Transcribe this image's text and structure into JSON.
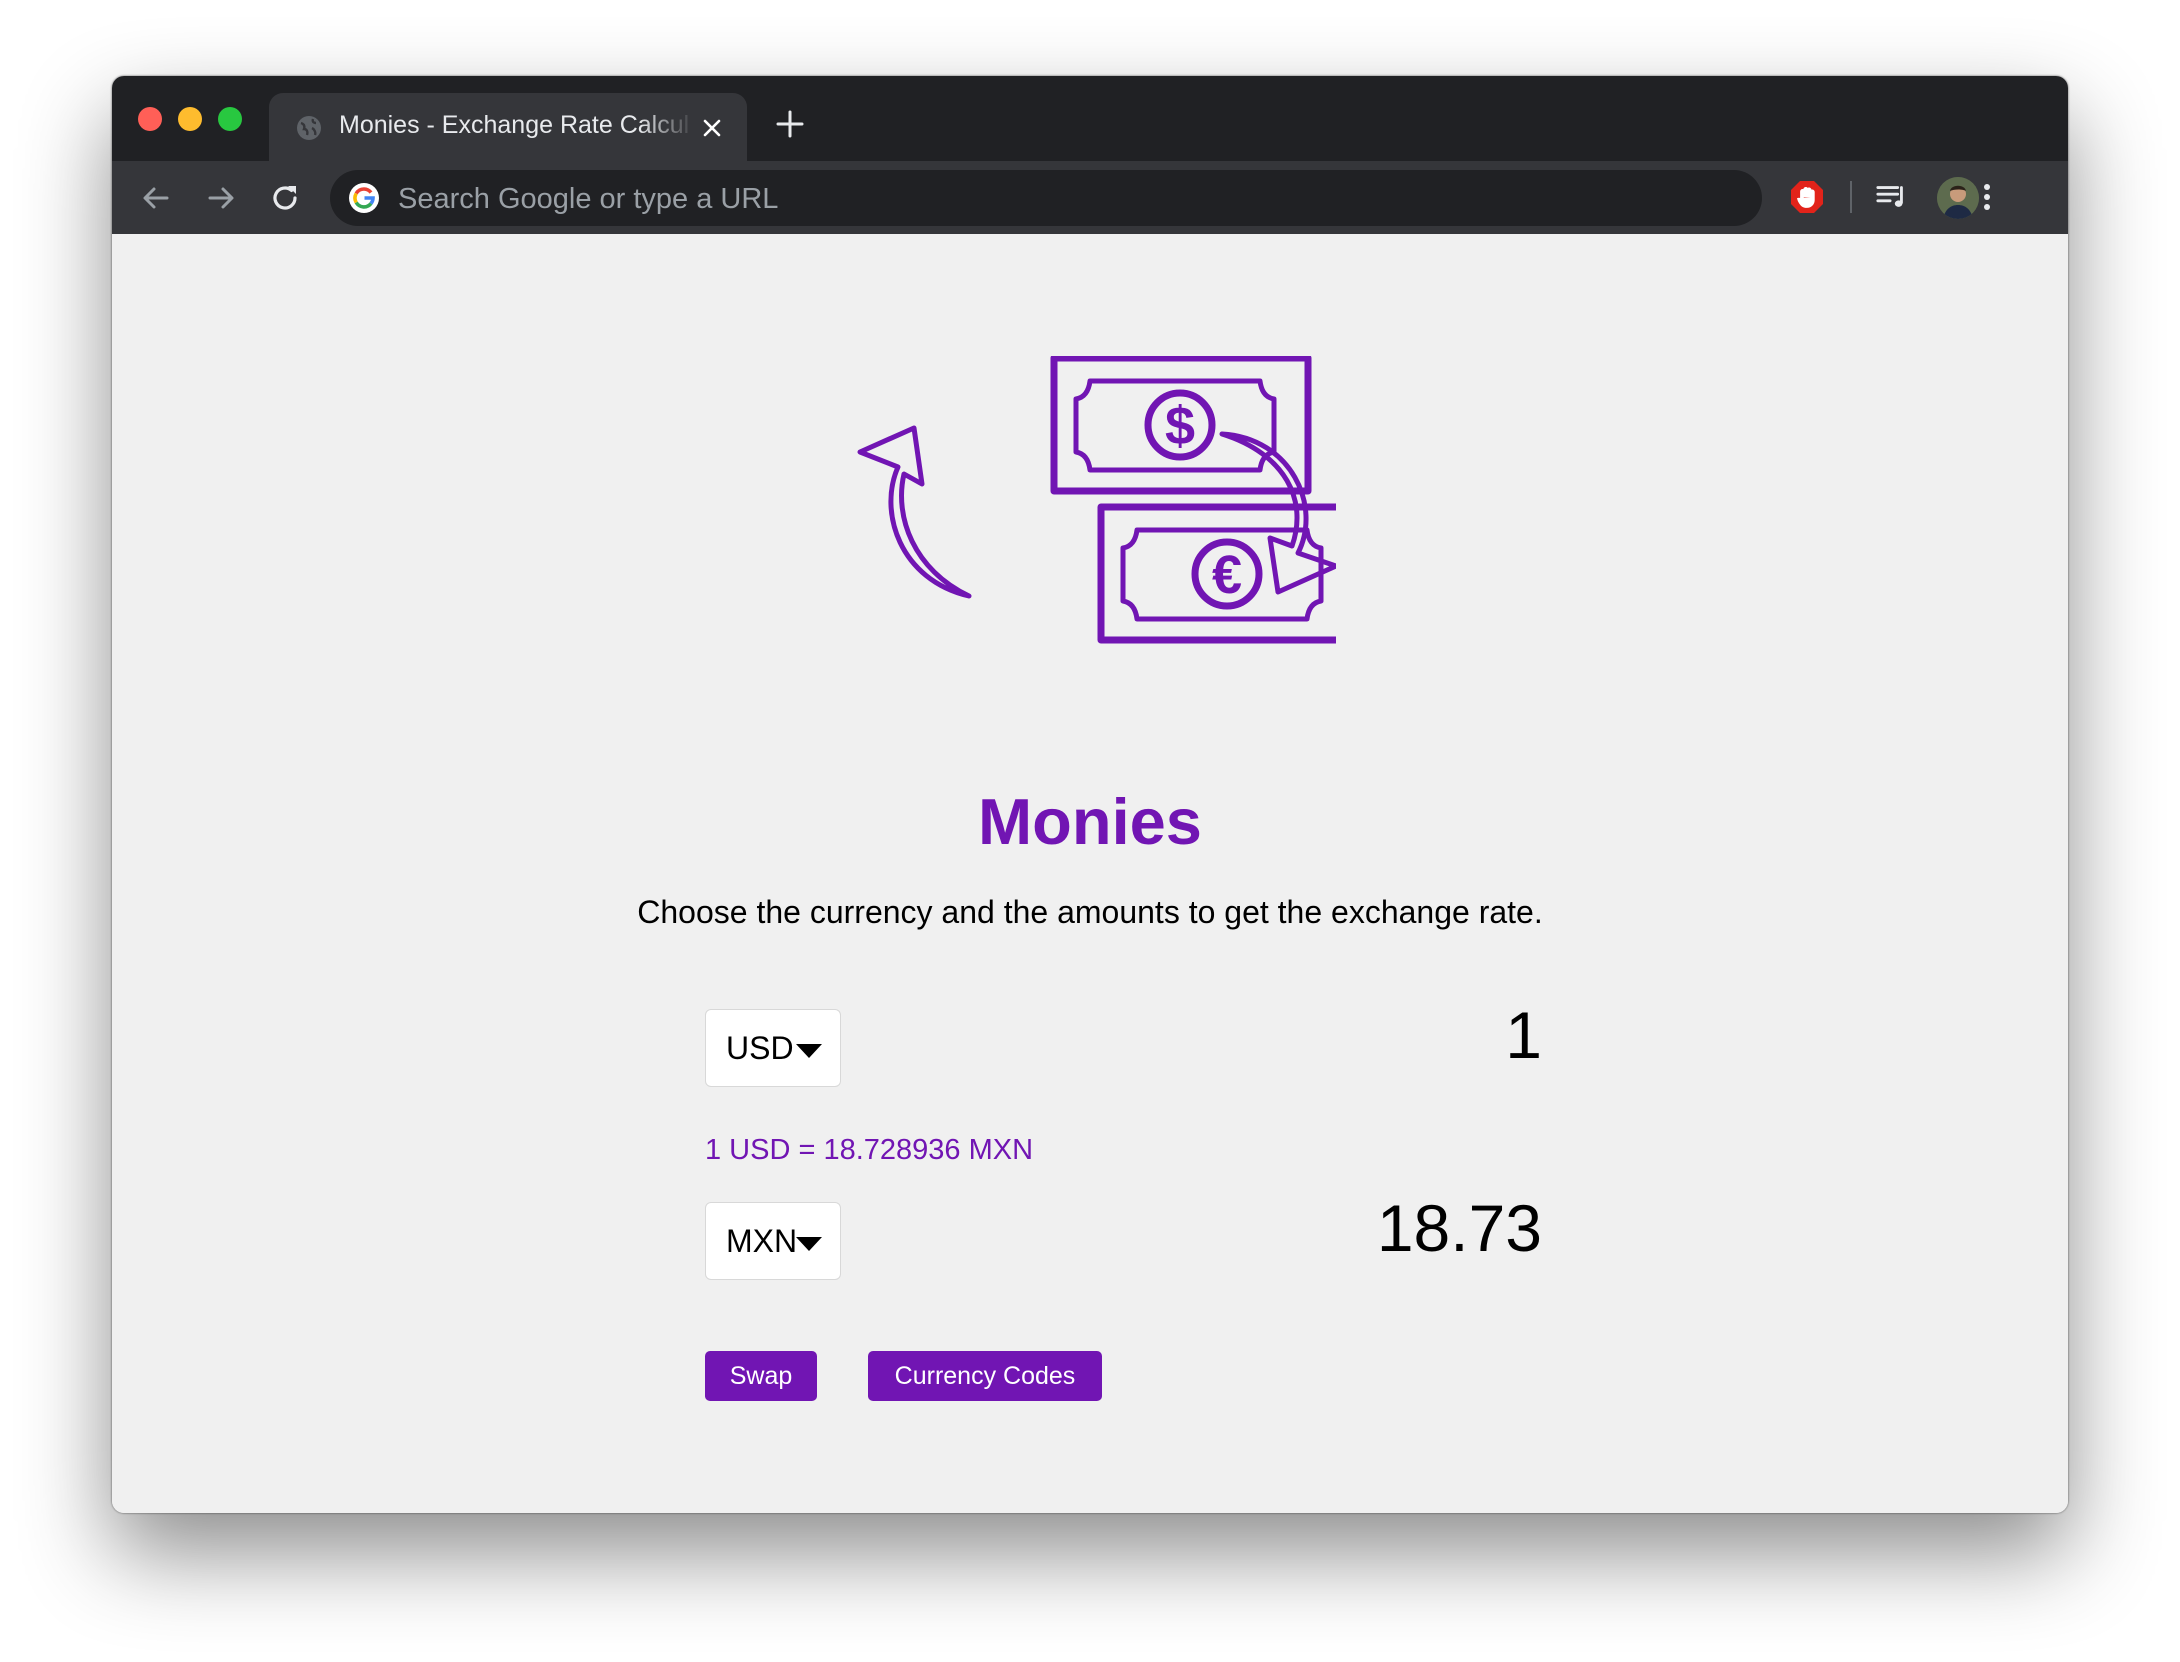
{
  "browser": {
    "tab_title": "Monies - Exchange Rate Calculator",
    "omnibox_placeholder": "Search Google or type a URL",
    "tab_favicon_icon": "globe-icon",
    "toolbar_icons": [
      "back-arrow-icon",
      "forward-arrow-icon",
      "reload-icon",
      "adblock-icon",
      "media-control-icon",
      "profile-avatar",
      "more-vert-icon"
    ]
  },
  "app": {
    "logo_icon": "currency-exchange-icon",
    "title": "Monies",
    "subtitle": "Choose the currency and the amounts to get the exchange rate.",
    "from": {
      "currency": "USD",
      "amount": "1"
    },
    "rate_text": "1 USD = 18.728936 MXN",
    "to": {
      "currency": "MXN",
      "amount": "18.73"
    },
    "buttons": {
      "swap": "Swap",
      "codes": "Currency Codes"
    }
  },
  "colors": {
    "accent": "#7115b3",
    "page_background": "#f0f0f0",
    "browser_chrome_dark": "#202124",
    "browser_chrome_light": "#35363a"
  }
}
